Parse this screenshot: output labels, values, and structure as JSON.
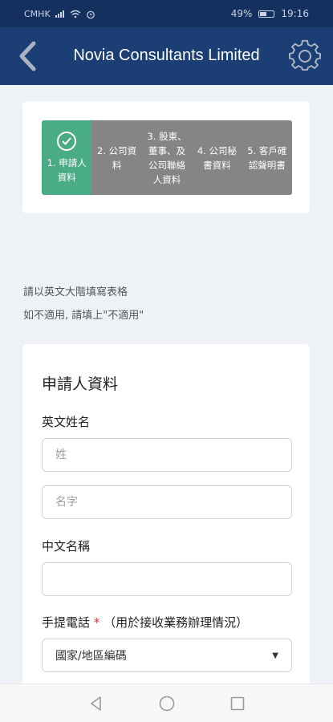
{
  "status_bar": {
    "carrier": "CMHK",
    "battery": "49%",
    "time": "19:16"
  },
  "header": {
    "title": "Novia Consultants Limited",
    "back_icon": "chevron-left-icon",
    "settings_icon": "gear-icon"
  },
  "stepper": {
    "steps": [
      {
        "label": "1. 申請人\n資料",
        "active": true
      },
      {
        "label": "2. 公司資\n料",
        "active": false
      },
      {
        "label": "3. 股東、\n董事、及\n公司聯絡\n人資料",
        "active": false
      },
      {
        "label": "4. 公司秘\n書資料",
        "active": false
      },
      {
        "label": "5. 客戶確\n認聲明書",
        "active": false
      }
    ],
    "colors": {
      "active": "#4aac86",
      "inactive": "#858585"
    }
  },
  "notes": {
    "line1": "請以英文大階填寫表格",
    "line2": "如不適用, 請填上\"不適用\""
  },
  "form": {
    "section_title": "申請人資料",
    "english_name_label": "英文姓名",
    "surname_placeholder": "姓",
    "given_name_placeholder": "名字",
    "chinese_name_label": "中文名稱",
    "chinese_name_value": "",
    "mobile_label": "手提電話",
    "mobile_required_mark": "*",
    "mobile_hint": "（用於接收業務辦理情況）",
    "country_code_selected": "國家/地區編碼"
  },
  "colors": {
    "header_bg": "#1b3e75",
    "status_bg": "#13305e",
    "page_bg": "#eef2f6",
    "required": "#d43b3b"
  }
}
